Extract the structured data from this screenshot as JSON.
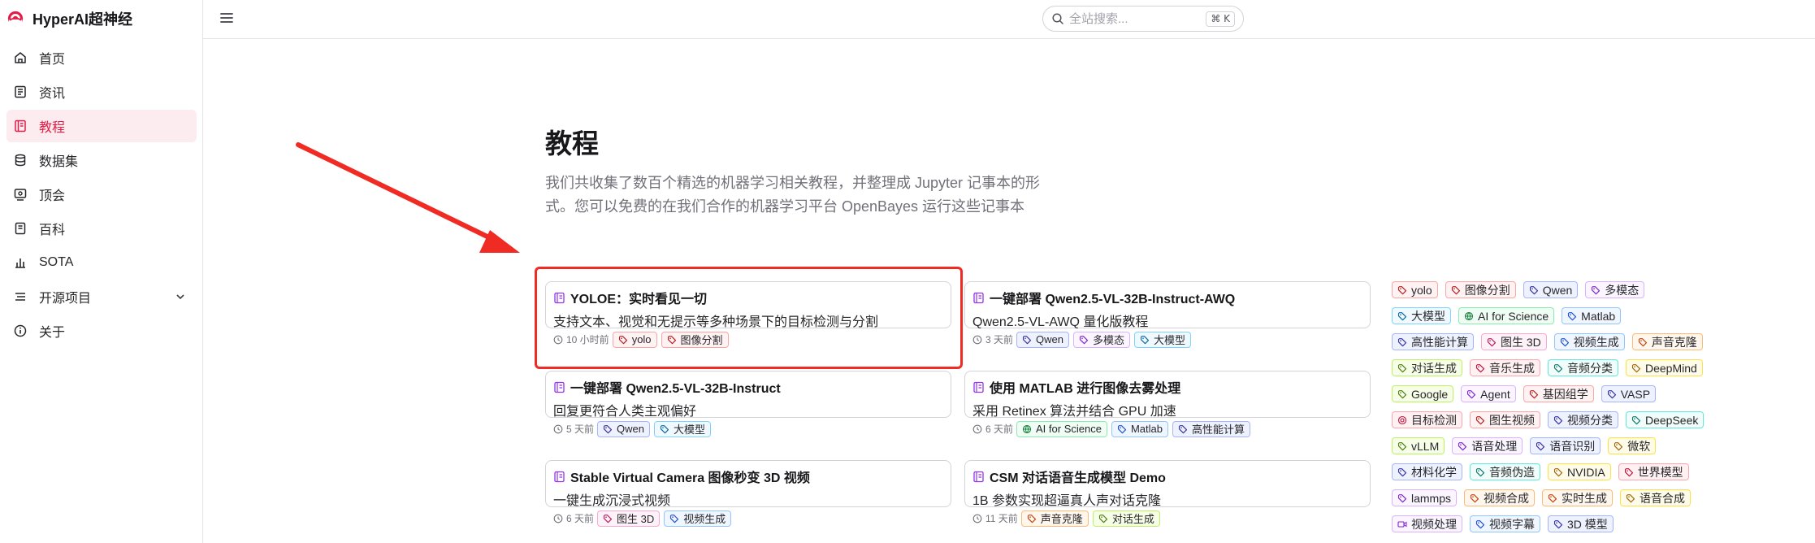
{
  "app": {
    "title": "HyperAI超神经"
  },
  "sidebar": {
    "items": [
      {
        "label": "首页",
        "icon": "home-icon"
      },
      {
        "label": "资讯",
        "icon": "news-icon"
      },
      {
        "label": "教程",
        "icon": "notebook-icon",
        "active": true
      },
      {
        "label": "数据集",
        "icon": "database-icon"
      },
      {
        "label": "顶会",
        "icon": "conference-icon"
      },
      {
        "label": "百科",
        "icon": "book-icon"
      },
      {
        "label": "SOTA",
        "icon": "chart-icon"
      },
      {
        "label": "开源项目",
        "icon": "list-icon",
        "expandable": true
      },
      {
        "label": "关于",
        "icon": "info-icon"
      }
    ]
  },
  "search": {
    "placeholder": "全站搜索...",
    "shortcut": "⌘ K"
  },
  "page": {
    "title": "教程",
    "description": "我们共收集了数百个精选的机器学习相关教程，并整理成 Jupyter 记事本的形式。您可以免费的在我们合作的机器学习平台 OpenBayes 运行这些记事本"
  },
  "cards": [
    {
      "title": "YOLOE：实时看见一切",
      "subtitle": "支持文本、视觉和无提示等多种场景下的目标检测与分割",
      "time": "10 小时前",
      "tags": [
        {
          "label": "yolo",
          "color": "red"
        },
        {
          "label": "图像分割",
          "color": "red"
        }
      ]
    },
    {
      "title": "一键部署 Qwen2.5-VL-32B-Instruct-AWQ",
      "subtitle": "Qwen2.5-VL-AWQ 量化版教程",
      "time": "3 天前",
      "tags": [
        {
          "label": "Qwen",
          "color": "indigo"
        },
        {
          "label": "多模态",
          "color": "purple"
        },
        {
          "label": "大模型",
          "color": "sky"
        }
      ]
    },
    {
      "title": "一键部署 Qwen2.5-VL-32B-Instruct",
      "subtitle": "回复更符合人类主观偏好",
      "time": "5 天前",
      "tags": [
        {
          "label": "Qwen",
          "color": "indigo"
        },
        {
          "label": "大模型",
          "color": "sky"
        }
      ]
    },
    {
      "title": "使用 MATLAB 进行图像去雾处理",
      "subtitle": "采用 Retinex 算法并结合 GPU 加速",
      "time": "6 天前",
      "tags": [
        {
          "label": "AI for Science",
          "color": "green",
          "icon": "globe"
        },
        {
          "label": "Matlab",
          "color": "blue"
        },
        {
          "label": "高性能计算",
          "color": "indigo"
        }
      ]
    },
    {
      "title": "Stable Virtual Camera 图像秒变 3D 视频",
      "subtitle": "一键生成沉浸式视频",
      "time": "6 天前",
      "tags": [
        {
          "label": "图生 3D",
          "color": "pink"
        },
        {
          "label": "视频生成",
          "color": "blue"
        }
      ]
    },
    {
      "title": "CSM 对话语音生成模型 Demo",
      "subtitle": "1B 参数实现超逼真人声对话克隆",
      "time": "11 天前",
      "tags": [
        {
          "label": "声音克隆",
          "color": "orange"
        },
        {
          "label": "对话生成",
          "color": "lime"
        }
      ]
    }
  ],
  "tagcloud": [
    [
      {
        "label": "yolo",
        "color": "red"
      },
      {
        "label": "图像分割",
        "color": "red"
      },
      {
        "label": "Qwen",
        "color": "indigo"
      },
      {
        "label": "多模态",
        "color": "purple"
      }
    ],
    [
      {
        "label": "大模型",
        "color": "sky"
      },
      {
        "label": "AI for Science",
        "color": "green",
        "icon": "globe"
      },
      {
        "label": "Matlab",
        "color": "blue"
      }
    ],
    [
      {
        "label": "高性能计算",
        "color": "indigo"
      },
      {
        "label": "图生 3D",
        "color": "pink"
      },
      {
        "label": "视频生成",
        "color": "blue"
      },
      {
        "label": "声音克隆",
        "color": "orange"
      }
    ],
    [
      {
        "label": "对话生成",
        "color": "lime"
      },
      {
        "label": "音乐生成",
        "color": "rose"
      },
      {
        "label": "音频分类",
        "color": "teal"
      },
      {
        "label": "DeepMind",
        "color": "yellow"
      }
    ],
    [
      {
        "label": "Google",
        "color": "lime"
      },
      {
        "label": "Agent",
        "color": "purple"
      },
      {
        "label": "基因组学",
        "color": "red"
      },
      {
        "label": "VASP",
        "color": "indigo"
      }
    ],
    [
      {
        "label": "目标检测",
        "color": "rose",
        "icon": "target"
      },
      {
        "label": "图生视频",
        "color": "red"
      },
      {
        "label": "视频分类",
        "color": "indigo"
      },
      {
        "label": "DeepSeek",
        "color": "teal"
      }
    ],
    [
      {
        "label": "vLLM",
        "color": "lime"
      },
      {
        "label": "语音处理",
        "color": "purple"
      },
      {
        "label": "语音识别",
        "color": "indigo"
      },
      {
        "label": "微软",
        "color": "yellow"
      }
    ],
    [
      {
        "label": "材料化学",
        "color": "indigo"
      },
      {
        "label": "音频伪造",
        "color": "teal"
      },
      {
        "label": "NVIDIA",
        "color": "yellow"
      },
      {
        "label": "世界模型",
        "color": "rose"
      }
    ],
    [
      {
        "label": "lammps",
        "color": "purple"
      },
      {
        "label": "视频合成",
        "color": "orange"
      },
      {
        "label": "实时生成",
        "color": "orange"
      },
      {
        "label": "语音合成",
        "color": "yellow"
      }
    ],
    [
      {
        "label": "视频处理",
        "color": "purple",
        "icon": "video"
      },
      {
        "label": "视频字幕",
        "color": "blue"
      },
      {
        "label": "3D 模型",
        "color": "indigo"
      }
    ]
  ],
  "colors": {
    "accent": "#e11d48",
    "annotation": "#ef2b24",
    "tags": {
      "red": [
        "#fef2f2",
        "#fca5a5",
        "#b91c1c"
      ],
      "indigo": [
        "#eef2ff",
        "#a5b4fc",
        "#3730a3"
      ],
      "purple": [
        "#faf5ff",
        "#d8b4fe",
        "#7e22ce"
      ],
      "sky": [
        "#f0f9ff",
        "#7dd3fc",
        "#0369a1"
      ],
      "green": [
        "#f0fdf4",
        "#86efac",
        "#15803d"
      ],
      "blue": [
        "#eff6ff",
        "#93c5fd",
        "#1d4ed8"
      ],
      "pink": [
        "#fdf2f8",
        "#f9a8d4",
        "#be185d"
      ],
      "orange": [
        "#fff7ed",
        "#fdba74",
        "#c2410c"
      ],
      "lime": [
        "#f7fee7",
        "#bef264",
        "#4d7c0f"
      ],
      "rose": [
        "#fff1f2",
        "#fda4af",
        "#be123c"
      ],
      "teal": [
        "#f0fdfa",
        "#5eead4",
        "#0f766e"
      ],
      "yellow": [
        "#fefce8",
        "#fde047",
        "#a16207"
      ]
    }
  }
}
